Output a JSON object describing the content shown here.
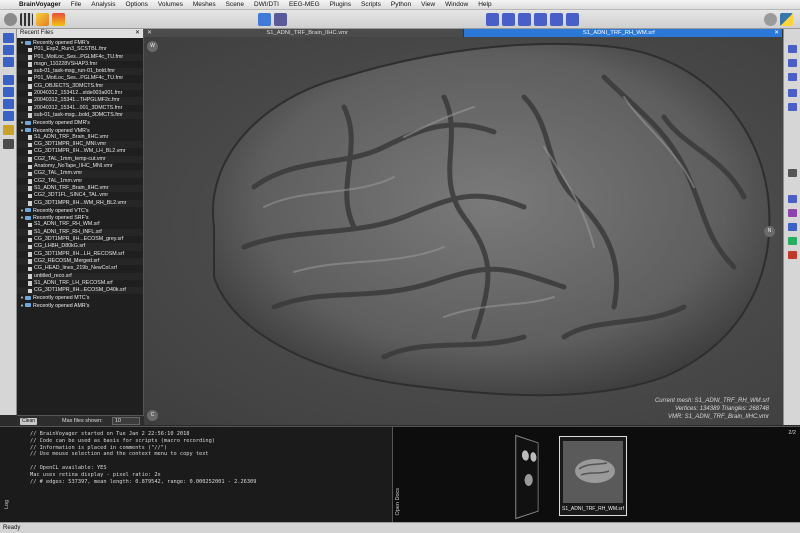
{
  "menubar": {
    "apple": "",
    "items": [
      "BrainVoyager",
      "File",
      "Analysis",
      "Options",
      "Volumes",
      "Meshes",
      "Scene",
      "DWI/DTI",
      "EEG-MEG",
      "Plugins",
      "Scripts",
      "Python",
      "View",
      "Window",
      "Help"
    ]
  },
  "toolbar": {
    "icons": [
      "brain-icon",
      "grid-icon",
      "pen-icon",
      "paint-icon",
      "open-folder-icon",
      "save-icon",
      "layout-1-icon",
      "layout-2-icon",
      "layout-3-icon",
      "layout-4-icon",
      "layout-5-icon",
      "layout-6-icon",
      "settings-icon",
      "python-icon"
    ]
  },
  "file_panel": {
    "title": "Recent Files",
    "close": "✕",
    "items": [
      {
        "type": "group",
        "label": "Recently opened FMR's"
      },
      {
        "type": "file",
        "label": "P01_Exp2_Run3_SCSTBL.fmr"
      },
      {
        "type": "file",
        "label": "P01_MotLoc_Ses...PGLMF4c_TU.fmr"
      },
      {
        "type": "file",
        "label": "msgn_110228VSHAP3.fmr"
      },
      {
        "type": "file",
        "label": "sub-01_task-msg_run-01_bold.fmr"
      },
      {
        "type": "file",
        "label": "P01_MotLoc_Ses...PGLMF4c_TU.fmr"
      },
      {
        "type": "file",
        "label": "CG_OBJECTS_3DMCTS.fmr"
      },
      {
        "type": "file",
        "label": "20040312_153412...stde003a001.fmr"
      },
      {
        "type": "file",
        "label": "20040312_15341...THPGLMF2c.fmr"
      },
      {
        "type": "file",
        "label": "20040312_15341...001_3DMCTS.fmr"
      },
      {
        "type": "file",
        "label": "sub-01_task-msg...bold_3DMCTS.fmr"
      },
      {
        "type": "group",
        "label": "Recently opened DMR's"
      },
      {
        "type": "group",
        "label": "Recently opened VMR's"
      },
      {
        "type": "file",
        "label": "S1_ADNI_TRF_Brain_IIHC.vmr"
      },
      {
        "type": "file",
        "label": "CG_3DT1MPR_IIHC_MNI.vmr"
      },
      {
        "type": "file",
        "label": "CG_3DT1MPR_IIH...WM_LH_BL2.vmr"
      },
      {
        "type": "file",
        "label": "CG2_TAL_1mm_temp-cut.vmr"
      },
      {
        "type": "file",
        "label": "Anatomy_NoTape_IIHC_MNI.vmr"
      },
      {
        "type": "file",
        "label": "CG2_TAL_1mm.vmr"
      },
      {
        "type": "file",
        "label": "CG2_TAL_1mm.vmr"
      },
      {
        "type": "file",
        "label": "S1_ADNI_TRF_Brain_IIHC.vmr"
      },
      {
        "type": "file",
        "label": "CG2_3DT1FL_SINC4_TAL.vmr"
      },
      {
        "type": "file",
        "label": "CG_3DT1MPR_IIH...WM_RH_BL2.vmr"
      },
      {
        "type": "group",
        "label": "Recently opened VTC's"
      },
      {
        "type": "group",
        "label": "Recently opened SRF's"
      },
      {
        "type": "file",
        "label": "S1_ADNI_TRF_RH_WM.srf"
      },
      {
        "type": "file",
        "label": "S1_ADNI_TRF_RH_INFL.srf"
      },
      {
        "type": "file",
        "label": "CG_3DT1MPR_IIH...ECOSM_grey.srf"
      },
      {
        "type": "file",
        "label": "CG_LH8H_D80kG.srf"
      },
      {
        "type": "file",
        "label": "CG_3DT1MPR_IIH...LH_RECOSM.srf"
      },
      {
        "type": "file",
        "label": "CG2_RECOSM_Merged.srf"
      },
      {
        "type": "file",
        "label": "CG_HEAD_lines_219b_NewCol.srf"
      },
      {
        "type": "file",
        "label": "untitled_reco.srf"
      },
      {
        "type": "file",
        "label": "S1_ADNI_TRF_LH_RECOSM.srf"
      },
      {
        "type": "file",
        "label": "CG_3DT1MPR_IIH...ECOSM_D40k.srf"
      },
      {
        "type": "group",
        "label": "Recently opened MTC's"
      },
      {
        "type": "group",
        "label": "Recently opened AMR's"
      }
    ]
  },
  "file_controls": {
    "clean_label": "Clean",
    "max_files_label": "Max files shown:",
    "max_files_value": "10"
  },
  "viewport": {
    "tabs": [
      {
        "label": "S1_ADNI_TRF_Brain_IIHC.vmr",
        "active": false
      },
      {
        "label": "S1_ADNI_TRF_RH_WM.srf",
        "active": true
      }
    ],
    "tab_close": "✕",
    "compass": {
      "west": "W",
      "north": "N",
      "center": "C"
    },
    "mesh_info": {
      "line1": "Current mesh: S1_ADNI_TRF_RH_WM.srf",
      "line2": "Vertices: 134389  Triangles: 268748",
      "line3": "VMR: S1_ADNI_TRF_Brain_IIHC.vmr"
    }
  },
  "log": {
    "label": "Log",
    "lines": [
      "// BrainVoyager started on Tue Jan 2 22:56:10 2018",
      "// Code can be used as basis for scripts (macro recording)",
      "// Information is placed in comments (\"//\")",
      "// Use mouse selection and the context menu to copy text",
      "",
      "// OpenCL available: YES",
      "Mac uses retina display - pixel ratio: 2x",
      "// # edges: 537397, mean length: 0.879542, range: 0.000252001 - 2.26309"
    ]
  },
  "docs": {
    "label": "Open Docs",
    "count": "2/2",
    "thumb_caption": "S1_ADNI_TRF_RH_WM.srf"
  },
  "status": {
    "text": "Ready"
  },
  "colors": {
    "active_tab": "#2c78d6",
    "mesh_gray": "#6b6b6b",
    "background": "#4a4a4a"
  }
}
